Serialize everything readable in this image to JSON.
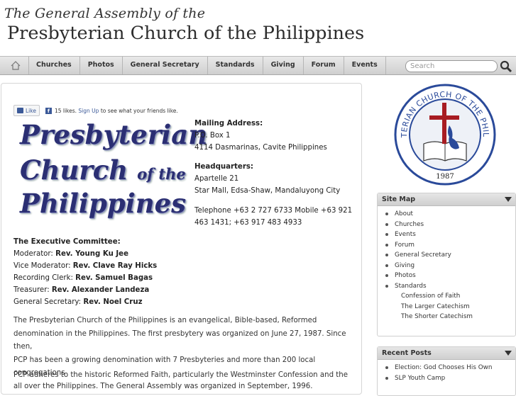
{
  "header": {
    "line1": "The General Assembly of the",
    "line2": "Presbyterian Church of the Philippines"
  },
  "nav": {
    "home_icon": "home-icon",
    "items": [
      "Churches",
      "Photos",
      "General Secretary",
      "Standards",
      "Giving",
      "Forum",
      "Events"
    ]
  },
  "search": {
    "placeholder": "Search",
    "icon": "magnifier-icon"
  },
  "facebook": {
    "like_label": "Like",
    "count_text": "15 likes.",
    "signup_link": "Sign Up",
    "signup_suffix": "to see what your friends like."
  },
  "logo": {
    "line1": "Presbyterian",
    "line2a": "Church",
    "line2b": "of the",
    "line3": "Philippines"
  },
  "contact": {
    "mailing_heading": "Mailing Address:",
    "mailing_1": "P.O. Box 1",
    "mailing_2": "4114 Dasmarinas, Cavite Philippines",
    "hq_heading": "Headquarters:",
    "hq_1": "Apartelle 21",
    "hq_2": "Star Mall, Edsa-Shaw, Mandaluyong City",
    "phone_1": "Telephone +63 2 727 6733 Mobile +63 921",
    "phone_2": "463 1431; +63 917 483 4933"
  },
  "executive": {
    "heading": "The Executive Committee:",
    "rows": [
      {
        "role": "Moderator:",
        "name": "Rev. Young Ku Jee"
      },
      {
        "role": "Vice Moderator:",
        "name": "Rev. Clave Ray Hicks"
      },
      {
        "role": "Recording Clerk:",
        "name": "Rev. Samuel Bagas"
      },
      {
        "role": "Treasurer:",
        "name": "Rev. Alexander Landeza"
      },
      {
        "role": "General Secretary:",
        "name": "Rev. Noel Cruz"
      }
    ]
  },
  "intro": {
    "p1_l1": "The Presbyterian Church of the Philippines is an evangelical, Bible-based, Reformed",
    "p1_l2": "denomination in the Philippines. The first presbytery was organized on June 27, 1987. Since then,",
    "p1_l3": "PCP has been a growing denomination with 7 Presbyteries and more than 200 local congregations",
    "p1_l4": "all over the Philippines. The General Assembly was organized in September, 1996.",
    "p2_l1": "PCP adheres to the historic Reformed Faith, particularly the Westminster Confession and the"
  },
  "seal": {
    "ring_text": "PRESBYTERIAN CHURCH OF THE PHILIPPINES",
    "year": "1987"
  },
  "sitemap": {
    "title": "Site Map",
    "items": [
      "About",
      "Churches",
      "Events",
      "Forum",
      "General Secretary",
      "Giving",
      "Photos",
      "Standards"
    ],
    "sub": [
      "Confession of Faith",
      "The Larger Catechism",
      "The Shorter Catechism"
    ]
  },
  "recent": {
    "title": "Recent Posts",
    "items": [
      "Election: God Chooses His Own",
      "SLP Youth Camp"
    ]
  },
  "colors": {
    "nav_bg": "#dcdcdc",
    "logo_blue": "#2b2f73",
    "fb_blue": "#3b5998",
    "seal_blue": "#2a4a9a",
    "cross_red": "#a81c22"
  }
}
